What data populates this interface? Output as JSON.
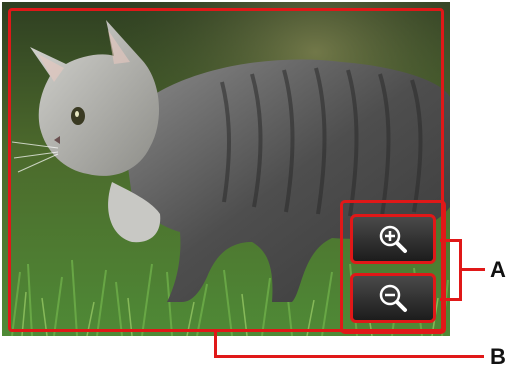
{
  "screen": {
    "photo": {
      "subject": "kitten-photo"
    },
    "zoom_in_button": {
      "icon": "zoom-in-icon"
    },
    "zoom_out_button": {
      "icon": "zoom-out-icon"
    }
  },
  "callouts": {
    "a_label": "A",
    "b_label": "B",
    "color": "#e01818"
  }
}
